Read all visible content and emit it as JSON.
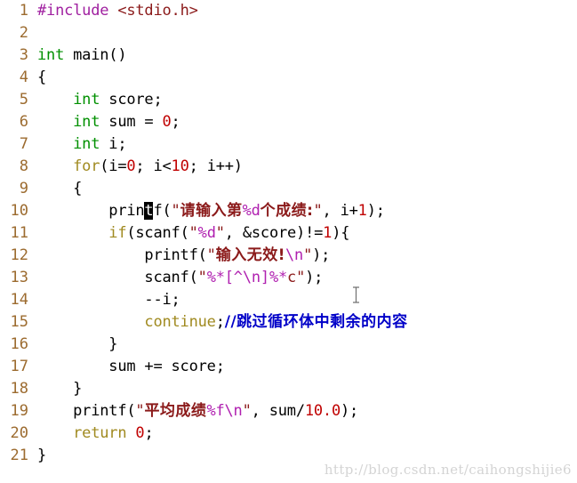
{
  "editor": {
    "background_color": "#ffffff",
    "font_size_px": 17,
    "line_height_px": 25,
    "total_lines": 21,
    "gutter_color": "#9C6B2F"
  },
  "syntax_colors": {
    "plain": "#000000",
    "keyword": "#A08A20",
    "type": "#009000",
    "preprocessor": "#A020A0",
    "header": "#8B1A1A",
    "string": "#8B1A1A",
    "format_specifier": "#B020B0",
    "number": "#C00000",
    "comment": "#0000C8",
    "caret_background": "#000000",
    "watermark": "#D4D4D4"
  },
  "caret": {
    "line": 10,
    "over_character": "t",
    "in_token": "printf"
  },
  "mouse_cursor": {
    "shape": "i-beam",
    "line": 13
  },
  "watermark": {
    "text": "http://blog.csdn.net/caihongshijie6"
  },
  "lines": [
    {
      "n": "1",
      "text": "#include <stdio.h>"
    },
    {
      "n": "2",
      "text": ""
    },
    {
      "n": "3",
      "text": "int main()"
    },
    {
      "n": "4",
      "text": "{"
    },
    {
      "n": "5",
      "text": "    int score;"
    },
    {
      "n": "6",
      "text": "    int sum = 0;"
    },
    {
      "n": "7",
      "text": "    int i;"
    },
    {
      "n": "8",
      "text": "    for(i=0; i<10; i++)"
    },
    {
      "n": "9",
      "text": "    {"
    },
    {
      "n": "10",
      "text": "        printf(\"请输入第%d个成绩:\", i+1);"
    },
    {
      "n": "11",
      "text": "        if(scanf(\"%d\", &score)!=1){"
    },
    {
      "n": "12",
      "text": "            printf(\"输入无效!\\n\");"
    },
    {
      "n": "13",
      "text": "            scanf(\"%*[^\\n]%*c\");"
    },
    {
      "n": "14",
      "text": "            --i;"
    },
    {
      "n": "15",
      "text": "            continue;//跳过循环体中剩余的内容"
    },
    {
      "n": "16",
      "text": "        }"
    },
    {
      "n": "17",
      "text": "        sum += score;"
    },
    {
      "n": "18",
      "text": "    }"
    },
    {
      "n": "19",
      "text": "    printf(\"平均成绩%f\\n\", sum/10.0);"
    },
    {
      "n": "20",
      "text": "    return 0;"
    },
    {
      "n": "21",
      "text": "}"
    }
  ],
  "tokens": {
    "l1_pre": "#include ",
    "l1_hdr": "<stdio.h>",
    "l3_type": "int",
    "l3_rest": " main()",
    "l4_brace": "{",
    "l5_indent": "    ",
    "l5_type": "int",
    "l5_rest": " score;",
    "l6_indent": "    ",
    "l6_type": "int",
    "l6_mid": " sum = ",
    "l6_num": "0",
    "l6_end": ";",
    "l7_indent": "    ",
    "l7_type": "int",
    "l7_rest": " i;",
    "l8_indent": "    ",
    "l8_kw": "for",
    "l8_a": "(i=",
    "l8_n1": "0",
    "l8_b": "; i<",
    "l8_n2": "10",
    "l8_c": "; i++)",
    "l9_brace": "    {",
    "l10_indent": "        ",
    "l10_fn_a": "prin",
    "l10_caret": "t",
    "l10_fn_b": "f(",
    "l10_q1": "\"",
    "l10_cjk1": "请输入第",
    "l10_fmt": "%d",
    "l10_cjk2": "个成绩:",
    "l10_q2": "\"",
    "l10_tail": ", i+",
    "l10_num": "1",
    "l10_end": ");",
    "l11_indent": "        ",
    "l11_kw": "if",
    "l11_a": "(scanf(",
    "l11_q1": "\"",
    "l11_fmt": "%d",
    "l11_q2": "\"",
    "l11_b": ", &score)!=",
    "l11_num": "1",
    "l11_c": "){",
    "l12_indent": "            ",
    "l12_fn": "printf(",
    "l12_q1": "\"",
    "l12_cjk": "输入无效!",
    "l12_esc": "\\n",
    "l12_q2": "\"",
    "l12_end": ");",
    "l13_indent": "            ",
    "l13_fn": "scanf(",
    "l13_q1": "\"",
    "l13_fmt1": "%*",
    "l13_br1": "[^",
    "l13_esc": "\\n",
    "l13_br2": "]",
    "l13_fmt2": "%*",
    "l13_c": "c",
    "l13_q2": "\"",
    "l13_end": ");",
    "l14_text": "            --i;",
    "l15_indent": "            ",
    "l15_kw": "continue",
    "l15_semi": ";",
    "l15_cmt": "//跳过循环体中剩余的内容",
    "l16_brace": "        }",
    "l17_text": "        sum += score;",
    "l18_brace": "    }",
    "l19_indent": "    ",
    "l19_fn": "printf(",
    "l19_q1": "\"",
    "l19_cjk": "平均成绩",
    "l19_fmt": "%f",
    "l19_esc": "\\n",
    "l19_q2": "\"",
    "l19_mid": ", sum/",
    "l19_num": "10.0",
    "l19_end": ");",
    "l20_indent": "    ",
    "l20_kw": "return",
    "l20_sp": " ",
    "l20_num": "0",
    "l20_end": ";",
    "l21_brace": "}"
  }
}
